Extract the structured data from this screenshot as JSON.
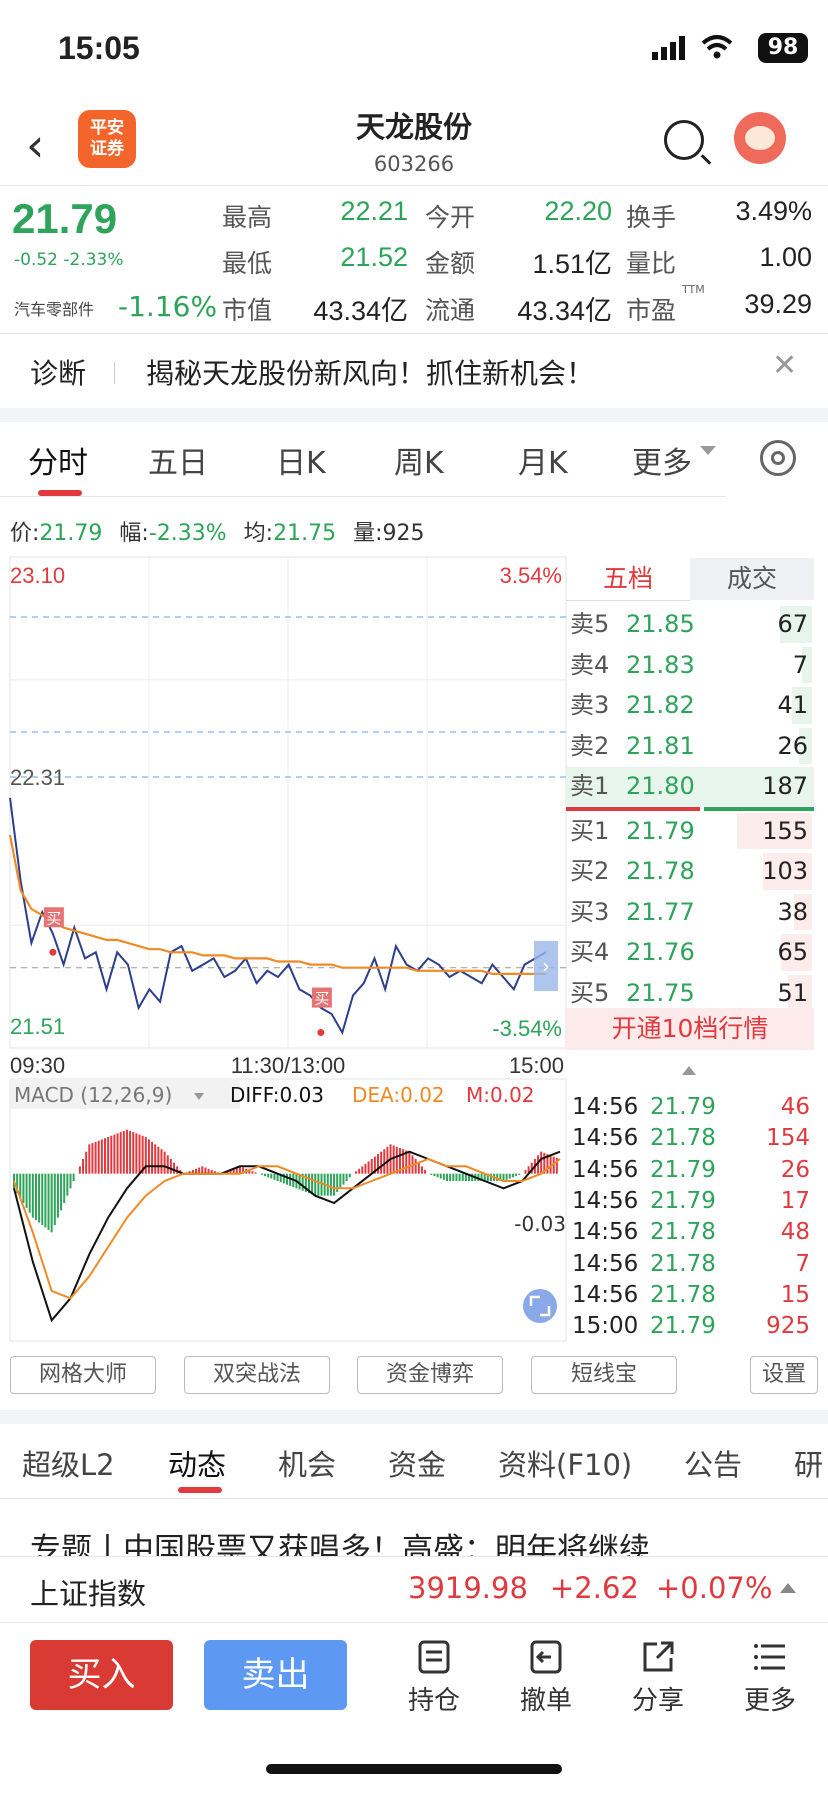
{
  "status_bar": {
    "time": "15:05",
    "battery": "98"
  },
  "header": {
    "broker_logo": "平安\n证券",
    "stock_name": "天龙股份",
    "stock_code": "603266"
  },
  "quote": {
    "price": "21.79",
    "change": "-0.52 -2.33%",
    "sector_name": "汽车零部件",
    "sector_change": "-1.16%",
    "fields": [
      {
        "label": "最高",
        "value": "22.21",
        "tone": "dn"
      },
      {
        "label": "今开",
        "value": "22.20",
        "tone": "dn"
      },
      {
        "label": "换手",
        "value": "3.49%",
        "tone": "plain"
      },
      {
        "label": "最低",
        "value": "21.52",
        "tone": "dn"
      },
      {
        "label": "金额",
        "value": "1.51亿",
        "tone": "plain"
      },
      {
        "label": "量比",
        "value": "1.00",
        "tone": "plain"
      },
      {
        "label": "市值",
        "value": "43.34亿",
        "tone": "plain"
      },
      {
        "label": "流通",
        "value": "43.34亿",
        "tone": "plain"
      },
      {
        "label": "市盈",
        "value": "39.29",
        "tone": "plain",
        "sup": "TTM"
      }
    ]
  },
  "notice": {
    "tag": "诊断",
    "text": "揭秘天龙股份新风向！抓住新机会！"
  },
  "chart_tabs": [
    "分时",
    "五日",
    "日K",
    "周K",
    "月K",
    "更多"
  ],
  "info_line": {
    "price_label": "价:",
    "price": "21.79",
    "range_label": "幅:",
    "range": "-2.33%",
    "avg_label": "均:",
    "avg": "21.75",
    "vol_label": "量:",
    "vol": "925"
  },
  "chart_data": [
    {
      "type": "line",
      "title": "分时",
      "x_ticks": [
        "09:30",
        "11:30/13:00",
        "15:00"
      ],
      "y_labels": {
        "top": "23.10",
        "ref": "22.31",
        "bottom": "21.51"
      },
      "pct_labels": {
        "top": "3.54%",
        "bottom": "-3.54%"
      },
      "ylim": [
        21.51,
        23.1
      ],
      "reference_price": 22.31,
      "series": [
        {
          "values": [
            22.32,
            22.05,
            21.85,
            21.95,
            21.88,
            21.78,
            21.9,
            21.8,
            21.82,
            21.7,
            21.82,
            21.78,
            21.64,
            21.7,
            21.66,
            21.82,
            21.84,
            21.76,
            21.78,
            21.8,
            21.74,
            21.76,
            21.8,
            21.72,
            21.76,
            21.74,
            21.78,
            21.7,
            21.68,
            21.64,
            21.62,
            21.56,
            21.68,
            21.72,
            21.8,
            21.7,
            21.84,
            21.78,
            21.76,
            21.8,
            21.78,
            21.74,
            21.76,
            21.74,
            21.72,
            21.78,
            21.74,
            21.7,
            21.78,
            21.8,
            21.82
          ]
        },
        {
          "values": [
            22.2,
            22.02,
            21.96,
            21.94,
            21.92,
            21.9,
            21.89,
            21.88,
            21.87,
            21.86,
            21.86,
            21.85,
            21.84,
            21.83,
            21.83,
            21.82,
            21.82,
            21.82,
            21.81,
            21.81,
            21.81,
            21.8,
            21.8,
            21.8,
            21.8,
            21.79,
            21.79,
            21.79,
            21.78,
            21.78,
            21.78,
            21.77,
            21.77,
            21.77,
            21.77,
            21.77,
            21.77,
            21.77,
            21.76,
            21.76,
            21.76,
            21.76,
            21.76,
            21.76,
            21.76,
            21.75,
            21.75,
            21.75,
            21.75,
            21.75,
            21.75
          ]
        }
      ],
      "annotations": [
        "买",
        "买"
      ]
    },
    {
      "type": "line",
      "title": "MACD (12,26,9)",
      "legend": [
        {
          "name": "DIFF",
          "value": "DIFF:0.03"
        },
        {
          "name": "DEA",
          "value": "DEA:0.02"
        },
        {
          "name": "M",
          "value": "M:0.02"
        }
      ],
      "y_label": "-0.03",
      "ylim": [
        -0.22,
        0.08
      ],
      "series": [
        {
          "name": "DIFF",
          "values": [
            -0.02,
            -0.12,
            -0.2,
            -0.17,
            -0.11,
            -0.06,
            -0.02,
            0.01,
            0.01,
            0.0,
            0.0,
            0.0,
            0.01,
            0.01,
            0.0,
            -0.01,
            -0.03,
            -0.04,
            -0.02,
            0.0,
            0.02,
            0.03,
            0.02,
            0.01,
            0.0,
            -0.01,
            -0.02,
            -0.01,
            0.02,
            0.03
          ]
        },
        {
          "name": "DEA",
          "values": [
            -0.01,
            -0.08,
            -0.16,
            -0.17,
            -0.14,
            -0.1,
            -0.06,
            -0.03,
            -0.01,
            0.0,
            0.0,
            0.0,
            0.0,
            0.01,
            0.01,
            0.0,
            -0.01,
            -0.02,
            -0.02,
            -0.01,
            0.0,
            0.01,
            0.02,
            0.01,
            0.01,
            0.0,
            -0.01,
            -0.01,
            0.0,
            0.02
          ]
        },
        {
          "name": "M",
          "values": [
            -0.02,
            -0.06,
            -0.08,
            -0.02,
            0.04,
            0.05,
            0.06,
            0.05,
            0.03,
            0.0,
            0.01,
            0.0,
            0.01,
            0.0,
            -0.01,
            -0.02,
            -0.03,
            -0.03,
            0.0,
            0.02,
            0.04,
            0.03,
            0.0,
            -0.01,
            -0.01,
            -0.01,
            -0.01,
            0.0,
            0.03,
            0.02
          ]
        }
      ]
    }
  ],
  "order_book": {
    "tabs": [
      "五档",
      "成交"
    ],
    "asks": [
      {
        "label": "卖5",
        "price": "21.85",
        "vol": "67",
        "bar": 0.36
      },
      {
        "label": "卖4",
        "price": "21.83",
        "vol": "7",
        "bar": 0.06
      },
      {
        "label": "卖3",
        "price": "21.82",
        "vol": "41",
        "bar": 0.22
      },
      {
        "label": "卖2",
        "price": "21.81",
        "vol": "26",
        "bar": 0.14
      },
      {
        "label": "卖1",
        "price": "21.80",
        "vol": "187",
        "bar": 1.0
      }
    ],
    "bids": [
      {
        "label": "买1",
        "price": "21.79",
        "vol": "155",
        "bar": 0.83
      },
      {
        "label": "买2",
        "price": "21.78",
        "vol": "103",
        "bar": 0.55
      },
      {
        "label": "买3",
        "price": "21.77",
        "vol": "38",
        "bar": 0.2
      },
      {
        "label": "买4",
        "price": "21.76",
        "vol": "65",
        "bar": 0.35
      },
      {
        "label": "买5",
        "price": "21.75",
        "vol": "51",
        "bar": 0.27
      }
    ],
    "open_level10": "开通10档行情",
    "ticks": [
      {
        "time": "14:56",
        "price": "21.79",
        "vol": "46",
        "dir": "up"
      },
      {
        "time": "14:56",
        "price": "21.78",
        "vol": "154",
        "dir": "up"
      },
      {
        "time": "14:56",
        "price": "21.79",
        "vol": "26",
        "dir": "up"
      },
      {
        "time": "14:56",
        "price": "21.79",
        "vol": "17",
        "dir": "up"
      },
      {
        "time": "14:56",
        "price": "21.78",
        "vol": "48",
        "dir": "up"
      },
      {
        "time": "14:56",
        "price": "21.78",
        "vol": "7",
        "dir": "up"
      },
      {
        "time": "14:56",
        "price": "21.78",
        "vol": "15",
        "dir": "up"
      },
      {
        "time": "15:00",
        "price": "21.79",
        "vol": "925",
        "dir": "up"
      }
    ]
  },
  "tools": [
    "网格大师",
    "双突战法",
    "资金博弈",
    "短线宝",
    "设置"
  ],
  "bottom_tabs": [
    "超级L2",
    "动态",
    "机会",
    "资金",
    "资料(F10)",
    "公告",
    "研"
  ],
  "news_headline": "专题丨中国股票又获唱多！高盛：明年将继续",
  "index_bar": {
    "name": "上证指数",
    "value": "3919.98",
    "change": "+2.62",
    "pct": "+0.07%"
  },
  "actions": {
    "buy": "买入",
    "sell": "卖出",
    "items": [
      "持仓",
      "撤单",
      "分享",
      "更多"
    ]
  },
  "colors": {
    "up": "#e0393e",
    "down": "#2ea35a",
    "avg_line": "#f08a24",
    "price_line": "#2b3f8c",
    "buy_button": "#da3a34",
    "sell_button": "#5d99f2"
  }
}
